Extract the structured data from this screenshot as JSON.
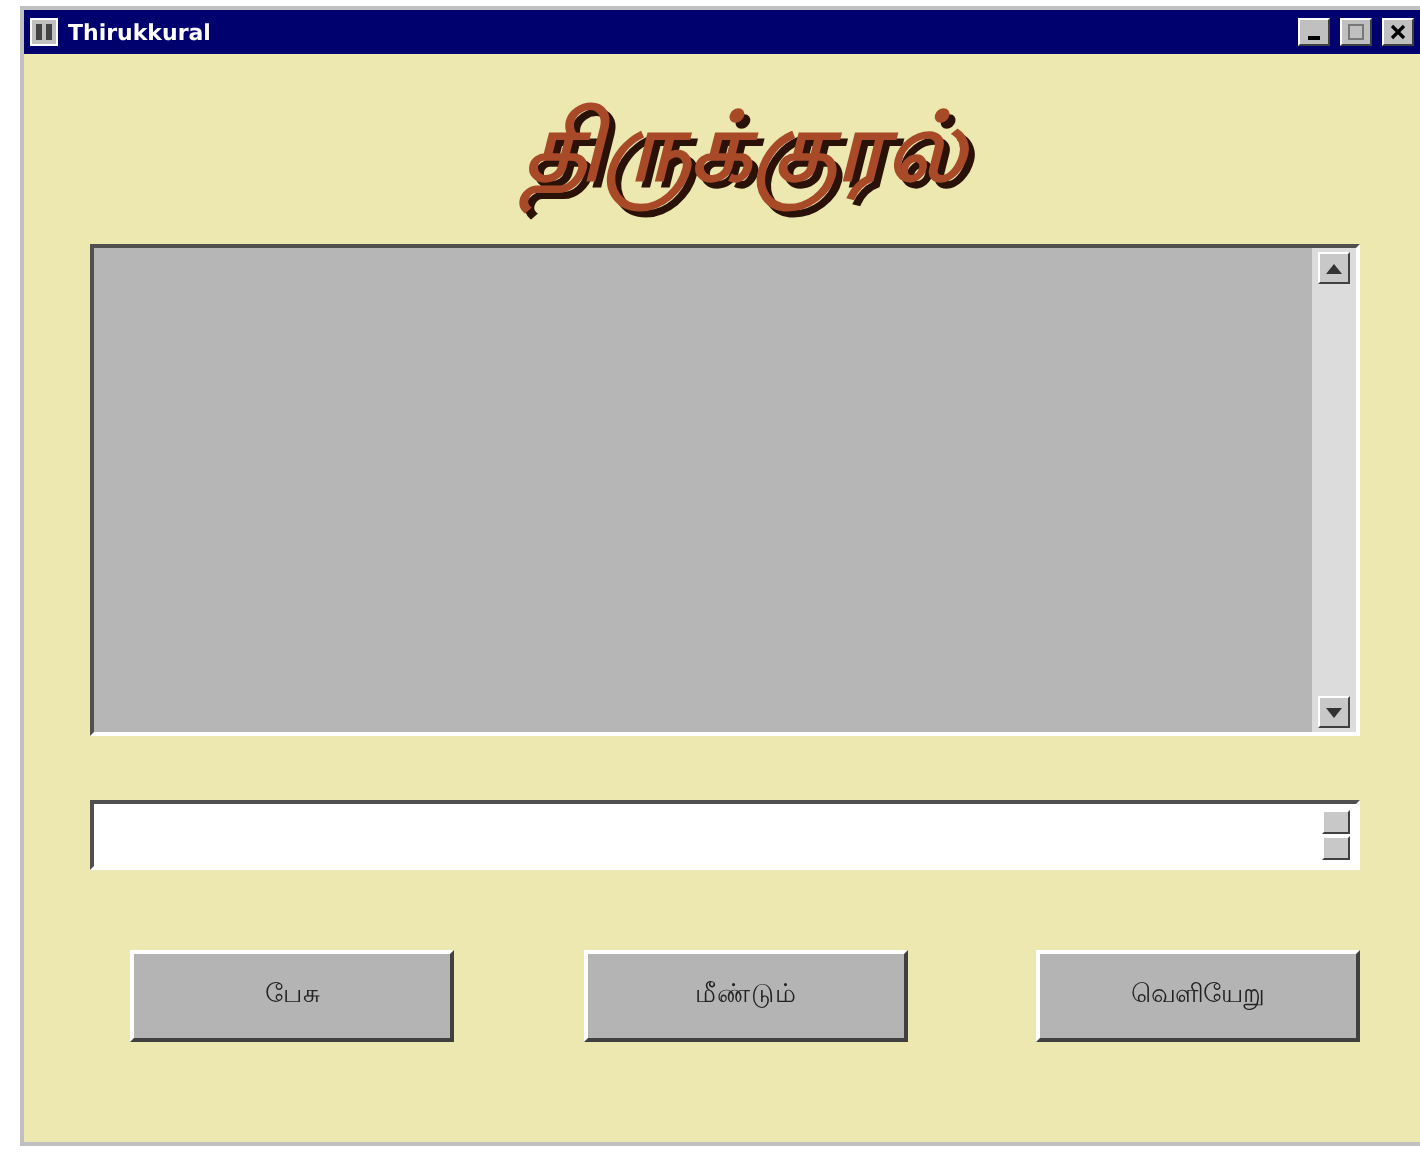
{
  "window": {
    "title": "Thirukkural"
  },
  "logo": {
    "text": "திருக்குரல்"
  },
  "display_area": {
    "kind": "textarea"
  },
  "input_field": {
    "kind": "input"
  },
  "buttons": [
    {
      "label": "பேசு"
    },
    {
      "label": "மீண்டும்"
    },
    {
      "label": "வெளியேறு"
    }
  ]
}
